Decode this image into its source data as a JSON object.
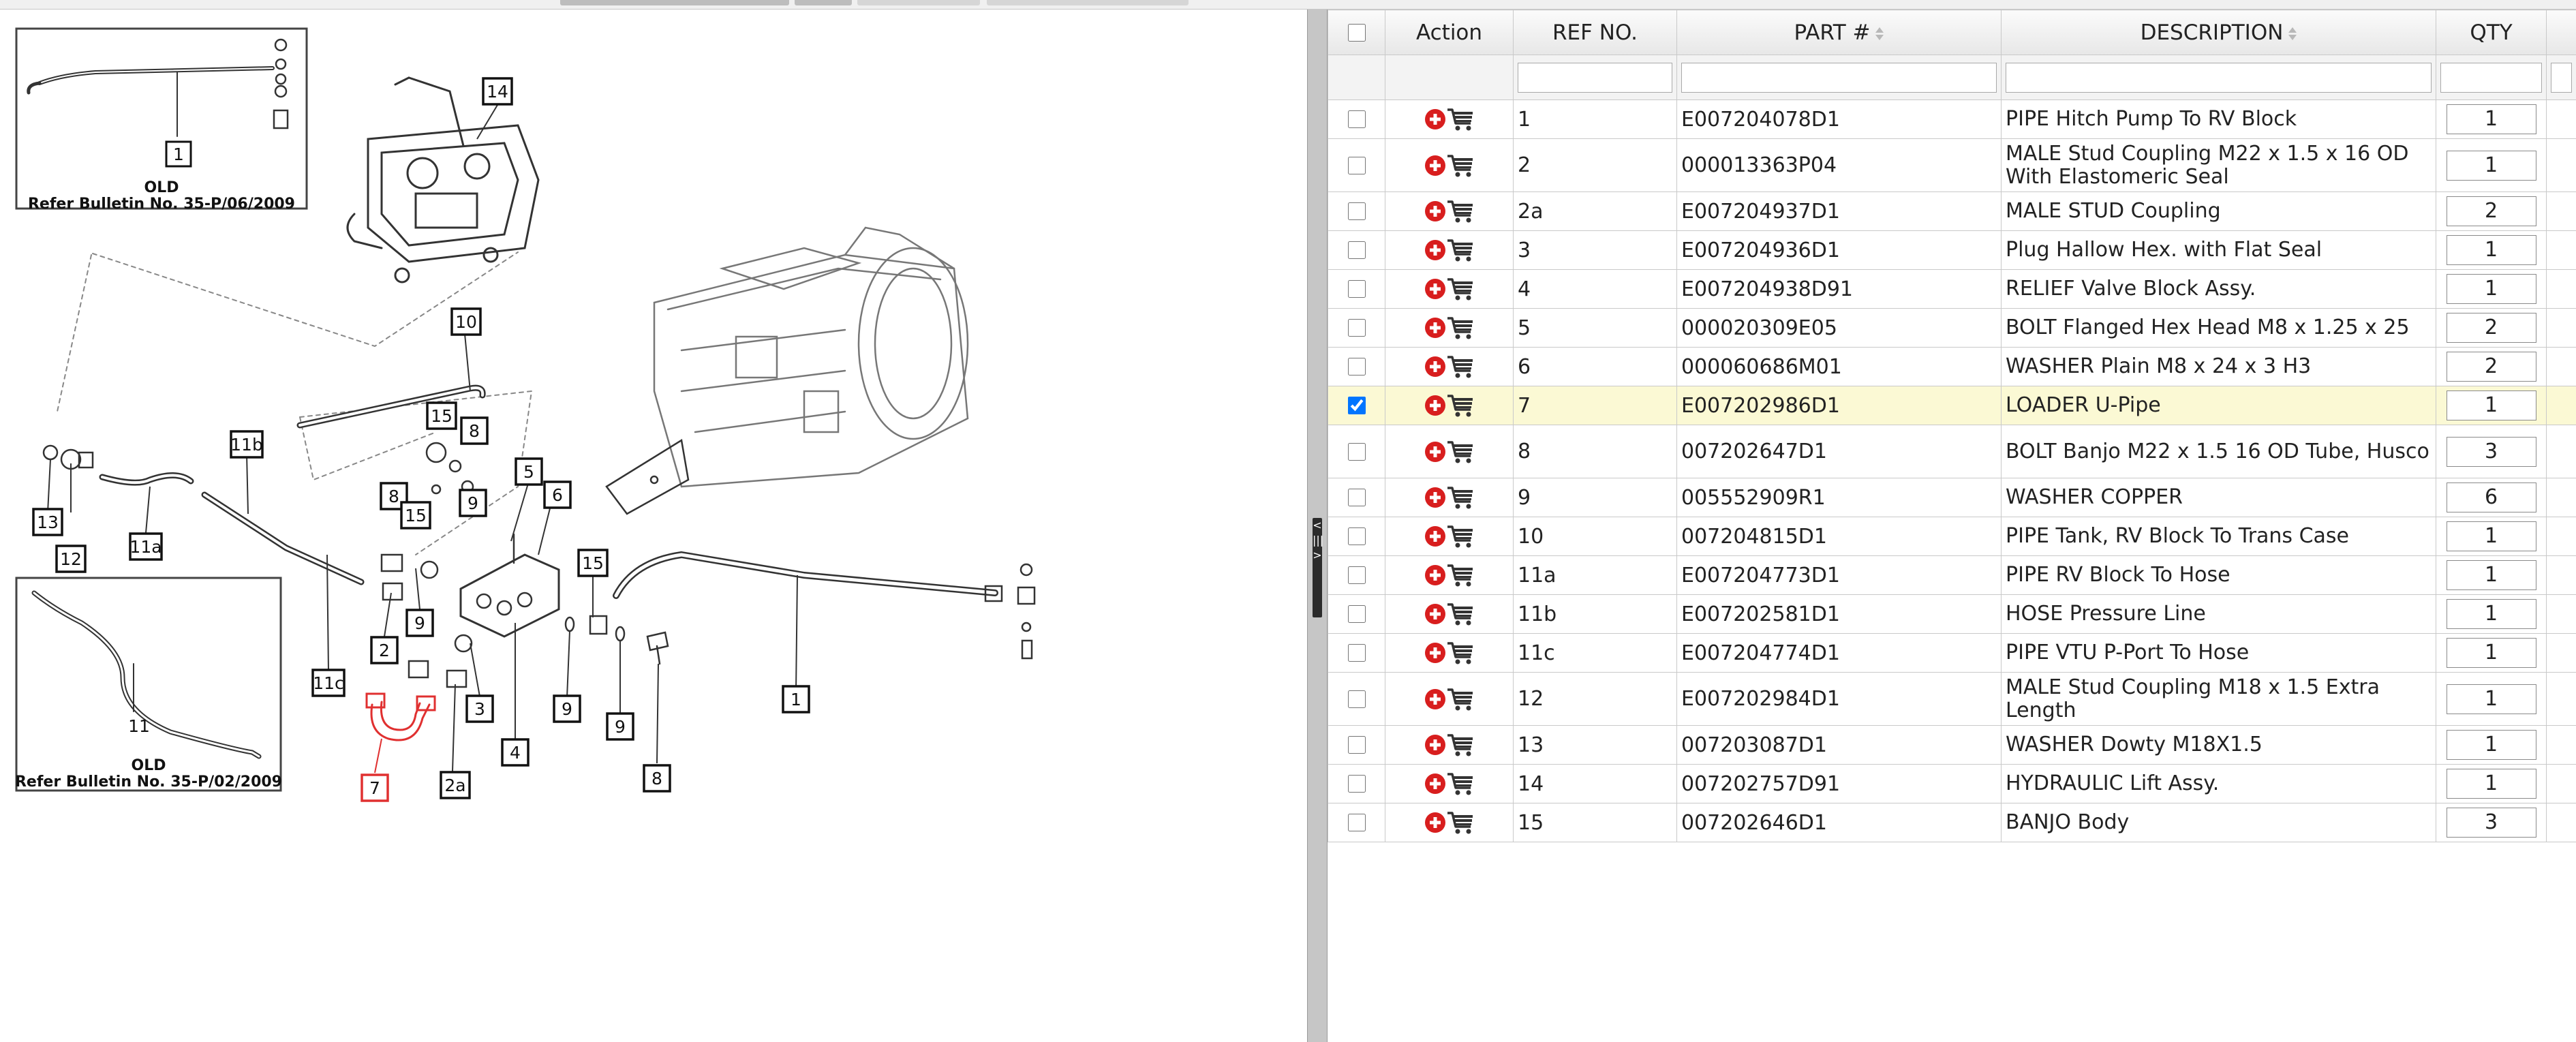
{
  "table": {
    "headers": {
      "action": "Action",
      "ref": "REF NO.",
      "part": "PART #",
      "description": "DESCRIPTION",
      "qty": "QTY"
    },
    "rows": [
      {
        "ref": "1",
        "part": "E007204078D1",
        "description": "PIPE Hitch Pump To RV Block",
        "qty": "1",
        "checked": false
      },
      {
        "ref": "2",
        "part": "000013363P04",
        "description": "MALE Stud Coupling M22 x 1.5 x 16 OD With Elastomeric Seal",
        "qty": "1",
        "checked": false
      },
      {
        "ref": "2a",
        "part": "E007204937D1",
        "description": "MALE STUD Coupling",
        "qty": "2",
        "checked": false
      },
      {
        "ref": "3",
        "part": "E007204936D1",
        "description": "Plug Hallow Hex. with Flat Seal",
        "qty": "1",
        "checked": false
      },
      {
        "ref": "4",
        "part": "E007204938D91",
        "description": "RELIEF Valve Block Assy.",
        "qty": "1",
        "checked": false
      },
      {
        "ref": "5",
        "part": "000020309E05",
        "description": "BOLT Flanged Hex Head M8 x 1.25 x 25",
        "qty": "2",
        "checked": false
      },
      {
        "ref": "6",
        "part": "000060686M01",
        "description": "WASHER Plain M8 x 24 x 3 H3",
        "qty": "2",
        "checked": false
      },
      {
        "ref": "7",
        "part": "E007202986D1",
        "description": "LOADER U-Pipe",
        "qty": "1",
        "checked": true
      },
      {
        "ref": "8",
        "part": "007202647D1",
        "description": "BOLT Banjo M22 x 1.5 16 OD Tube, Husco",
        "qty": "3",
        "checked": false
      },
      {
        "ref": "9",
        "part": "005552909R1",
        "description": "WASHER COPPER",
        "qty": "6",
        "checked": false
      },
      {
        "ref": "10",
        "part": "007204815D1",
        "description": "PIPE Tank, RV Block To Trans Case",
        "qty": "1",
        "checked": false
      },
      {
        "ref": "11a",
        "part": "E007204773D1",
        "description": "PIPE RV Block To Hose",
        "qty": "1",
        "checked": false
      },
      {
        "ref": "11b",
        "part": "E007202581D1",
        "description": "HOSE Pressure Line",
        "qty": "1",
        "checked": false
      },
      {
        "ref": "11c",
        "part": "E007204774D1",
        "description": "PIPE VTU P-Port To Hose",
        "qty": "1",
        "checked": false
      },
      {
        "ref": "12",
        "part": "E007202984D1",
        "description": "MALE Stud Coupling M18 x 1.5 Extra Length",
        "qty": "1",
        "checked": false
      },
      {
        "ref": "13",
        "part": "007203087D1",
        "description": "WASHER Dowty M18X1.5",
        "qty": "1",
        "checked": false
      },
      {
        "ref": "14",
        "part": "007202757D91",
        "description": "HYDRAULIC Lift Assy.",
        "qty": "1",
        "checked": false
      },
      {
        "ref": "15",
        "part": "007202646D1",
        "description": "BANJO Body",
        "qty": "3",
        "checked": false
      }
    ]
  },
  "diagram": {
    "callouts": [
      "1",
      "2",
      "2a",
      "3",
      "4",
      "5",
      "6",
      "7",
      "8",
      "8",
      "8",
      "9",
      "9",
      "9",
      "9",
      "10",
      "11a",
      "11b",
      "11c",
      "12",
      "13",
      "14",
      "15",
      "15",
      "15"
    ],
    "selected_callout": "7",
    "inset_top": {
      "label": "OLD",
      "bulletin": "Refer Bulletin No. 35-P/06/2009",
      "callout": "1"
    },
    "inset_bottom": {
      "label": "OLD",
      "bulletin": "Refer Bulletin No. 35-P/02/2009",
      "callout": "11"
    }
  },
  "splitter": {
    "label": "< ||| >"
  },
  "colors": {
    "selected_row": "#fbf9d4",
    "highlight_part": "#e03030",
    "header_bg": "#ececec",
    "splitter": "#c6c6c6"
  },
  "icons": {
    "add": "add-circle-icon",
    "cart": "cart-icon",
    "sort": "sort-icon"
  }
}
